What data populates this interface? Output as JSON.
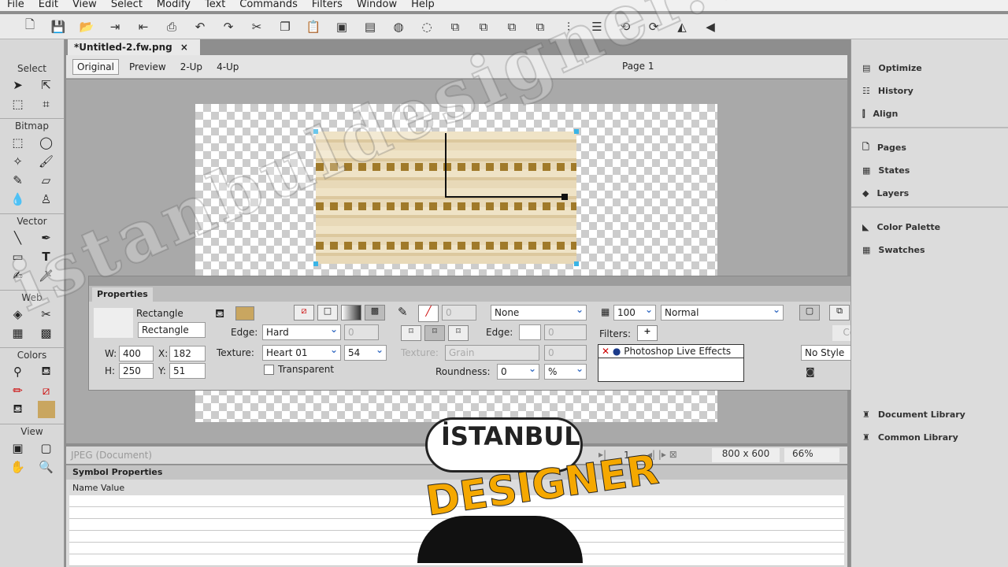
{
  "menu": [
    "File",
    "Edit",
    "View",
    "Select",
    "Modify",
    "Text",
    "Commands",
    "Filters",
    "Window",
    "Help"
  ],
  "document": {
    "tab": "*Untitled-2.fw.png",
    "close": "×",
    "views": [
      "Original",
      "Preview",
      "2-Up",
      "4-Up"
    ],
    "page": "Page 1"
  },
  "tools": {
    "sections": [
      "Select",
      "Bitmap",
      "Vector",
      "Web",
      "Colors",
      "View"
    ]
  },
  "properties": {
    "tab": "Properties",
    "type": "Rectangle",
    "name": "Rectangle",
    "w_label": "W:",
    "w": "400",
    "h_label": "H:",
    "h": "250",
    "x_label": "X:",
    "x": "182",
    "y_label": "Y:",
    "y": "51",
    "edge_label": "Edge:",
    "edge": "Hard",
    "edge_val": "0",
    "texture_label": "Texture:",
    "texture": "Heart 01",
    "texture_amount": "54",
    "transparent": "Transparent",
    "stroke_size": "0",
    "stroke_type": "None",
    "stroke_edge_label": "Edge:",
    "stroke_edge": "0",
    "stroke_texture_label": "Texture:",
    "stroke_texture": "Grain",
    "stroke_texture_amount": "0",
    "roundness_label": "Roundness:",
    "roundness": "0",
    "roundness_unit": "%",
    "opacity": "100",
    "blend": "Normal",
    "filters_label": "Filters:",
    "filter_item": "Photoshop Live Effects",
    "combine": "Combine",
    "style": "No Style"
  },
  "right_panel": {
    "group1": [
      "Optimize",
      "History",
      "Align"
    ],
    "group2": [
      "Pages",
      "States",
      "Layers"
    ],
    "group3": [
      "Color Palette",
      "Swatches"
    ],
    "group4": [
      "Document Library",
      "Common Library"
    ]
  },
  "status": {
    "format": "JPEG (Document)",
    "frame": "1",
    "size": "800 x 600",
    "zoom": "66%"
  },
  "symbol_properties": {
    "title": "Symbol Properties",
    "col_name": "Name",
    "col_value": "Value"
  },
  "logo": {
    "line1": "İSTANBUL",
    "line2": "DESIGNER"
  },
  "watermark": "istanbuldesigner.com",
  "colors": {
    "accent": "#3a6fc4",
    "handle": "#3ab4e6",
    "logo": "#f5a800"
  }
}
